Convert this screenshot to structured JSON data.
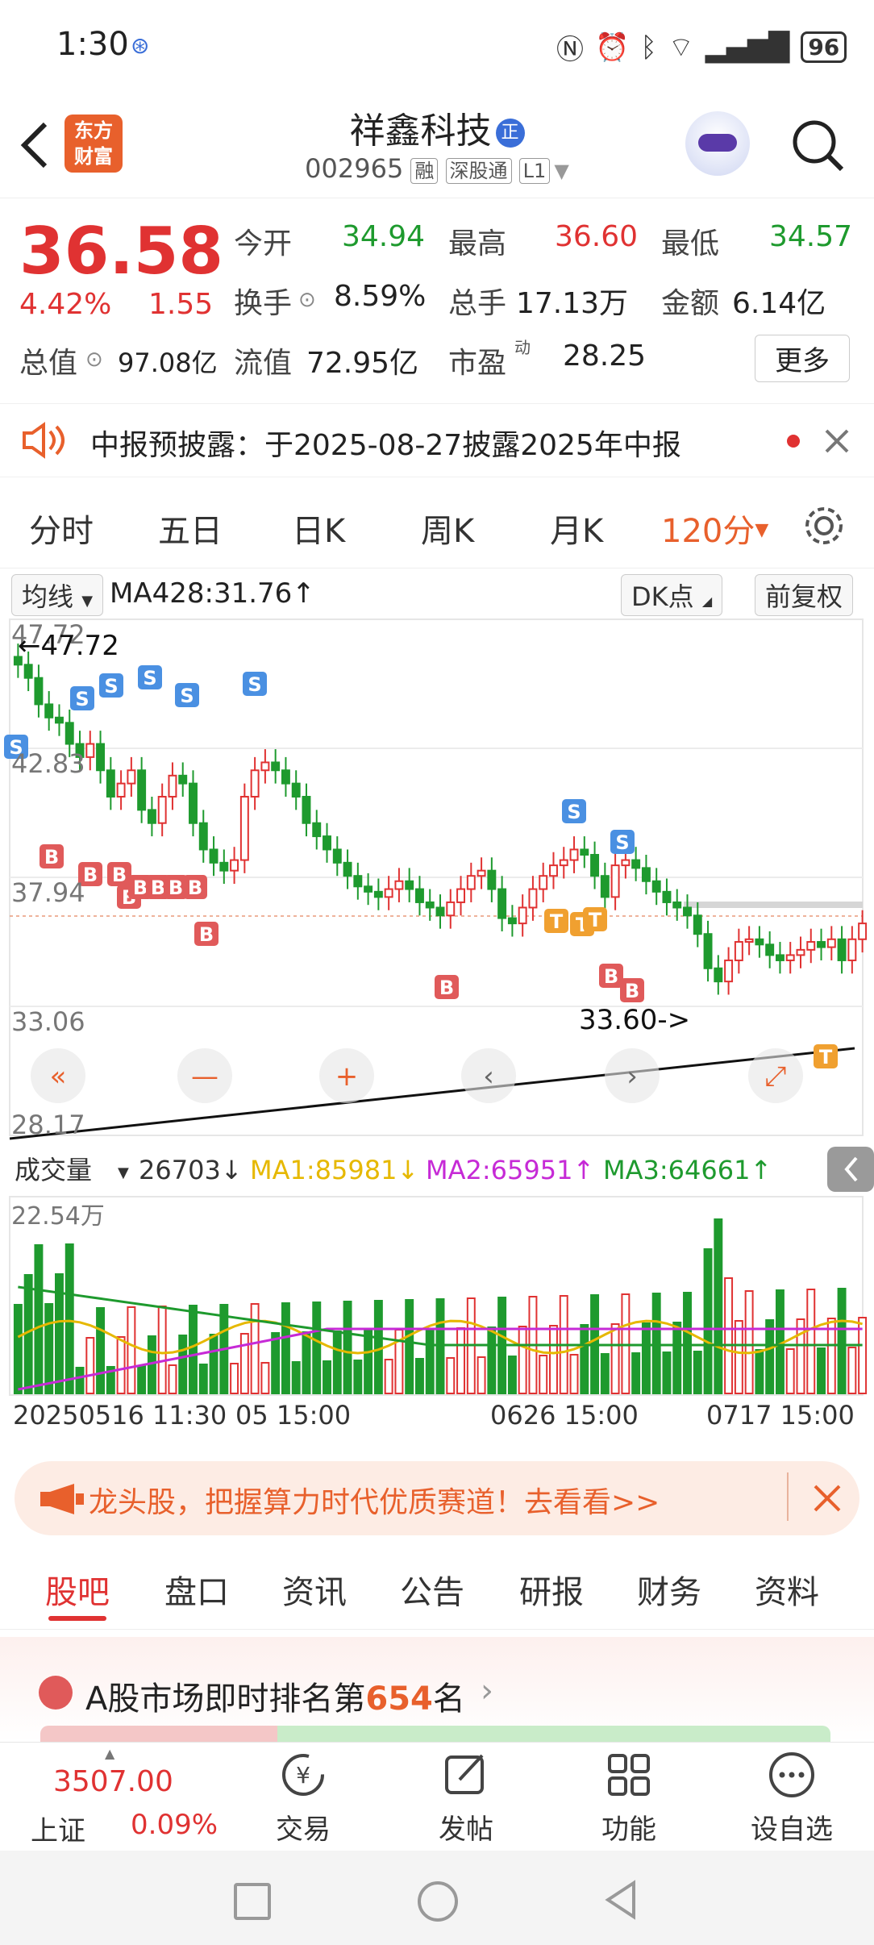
{
  "status_bar": {
    "time": "1:30",
    "battery": "96"
  },
  "header": {
    "back_icon": "back-arrow-icon",
    "logo_line1": "东方",
    "logo_line2": "财富",
    "stock_name": "祥鑫科技",
    "stock_code": "002965",
    "tag_margin": "融",
    "tag_connect": "深股通",
    "tag_level": "L1",
    "badge": "正"
  },
  "quote": {
    "price": "36.58",
    "change_pct": "4.42%",
    "change": "1.55",
    "open_label": "今开",
    "open": "34.94",
    "high_label": "最高",
    "high": "36.60",
    "low_label": "最低",
    "low": "34.57",
    "turnover_label": "换手",
    "turnover": "8.59%",
    "volume_label": "总手",
    "volume": "17.13万",
    "amount_label": "金额",
    "amount": "6.14亿",
    "mcap_label": "总值",
    "mcap": "97.08亿",
    "float_label": "流值",
    "float": "72.95亿",
    "pe_label": "市盈",
    "pe_sup": "动",
    "pe": "28.25",
    "more_label": "更多"
  },
  "notice": {
    "text": "中报预披露：于2025-08-27披露2025年中报"
  },
  "kline_tabs": [
    "分时",
    "五日",
    "日K",
    "周K",
    "月K"
  ],
  "kline_active_tab": "120分",
  "chart": {
    "ma_selector": "均线",
    "ma_label": "MA428:31.76↑",
    "dk_label": "DK点",
    "adjust_label": "前复权",
    "price_axis": [
      "47.72",
      "42.83",
      "37.94",
      "33.06",
      "28.17"
    ],
    "high_annotation": "←47.72",
    "low_annotation": "33.60->",
    "volume_selector": "成交量",
    "volume_value": "26703↓",
    "ma1": "MA1:85981↓",
    "ma2": "MA2:65951↑",
    "ma3": "MA3:64661↑",
    "volume_axis_max": "22.54万",
    "x_labels": [
      "20250516 11:30",
      "05 15:00",
      "0626 15:00",
      "0717 15:00"
    ],
    "controls": [
      "«",
      "—",
      "+",
      "‹",
      "›",
      "⤢"
    ]
  },
  "ad": {
    "text": "龙头股，把握算力时代优质赛道！去看看>>"
  },
  "bottom_tabs": [
    "股吧",
    "盘口",
    "资讯",
    "公告",
    "研报",
    "财务",
    "资料"
  ],
  "bottom_tab_active": "股吧",
  "rank": {
    "prefix": "A股市场即时排名第",
    "number": "654",
    "suffix": "名"
  },
  "bottom_nav": {
    "index_value": "3507.00",
    "index_name": "上证",
    "index_change": "0.09%",
    "items": [
      "交易",
      "发帖",
      "功能",
      "设自选"
    ]
  },
  "colors": {
    "up": "#e03232",
    "down": "#1e9a2e",
    "accent": "#e8602c",
    "ma1": "#e6b800",
    "ma2": "#c62ad6",
    "ma3": "#1e9a2e"
  }
}
